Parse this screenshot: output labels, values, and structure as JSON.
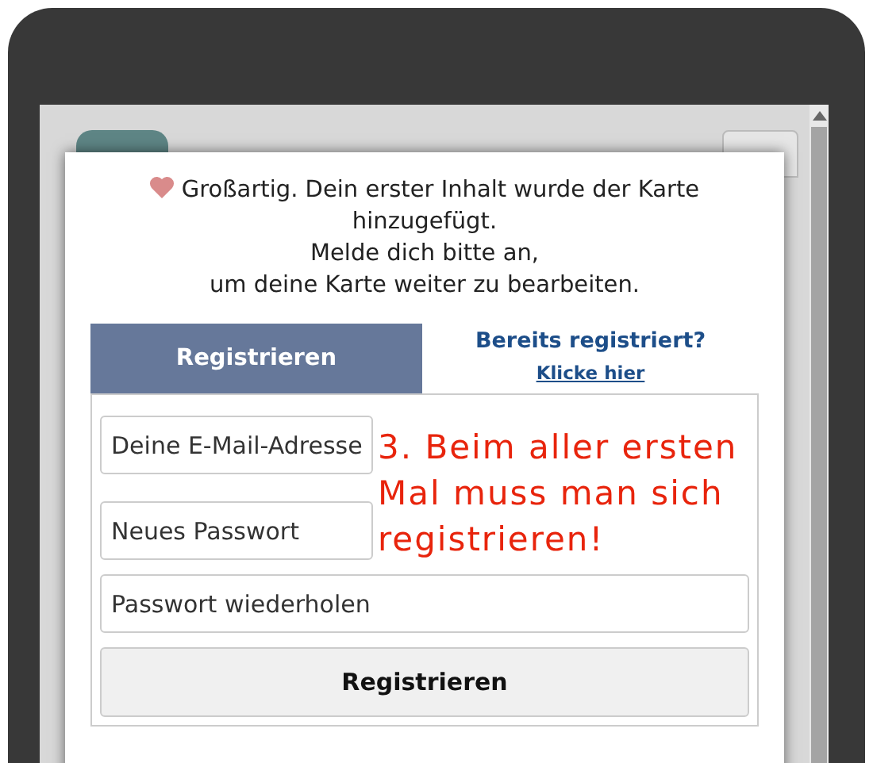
{
  "message": {
    "lines": [
      "Großartig. Dein erster Inhalt wurde der Karte hinzugefügt.",
      "Melde dich bitte an,",
      "um deine Karte weiter zu bearbeiten."
    ]
  },
  "tabs": [
    {
      "kind": "tab",
      "label": "Registrieren",
      "selected": true
    },
    {
      "kind": "link",
      "label": "Bereits registriert?",
      "link": "Klicke hier",
      "selected": false
    }
  ],
  "fields": [
    {
      "placeholder": "Deine E-Mail-Adresse"
    },
    {
      "placeholder": "Neues Passwort"
    },
    {
      "placeholder": "Passwort wiederholen"
    }
  ],
  "submit": "Registrieren",
  "annotation": "3. Beim aller ersten Mal muss man sich registrieren!"
}
